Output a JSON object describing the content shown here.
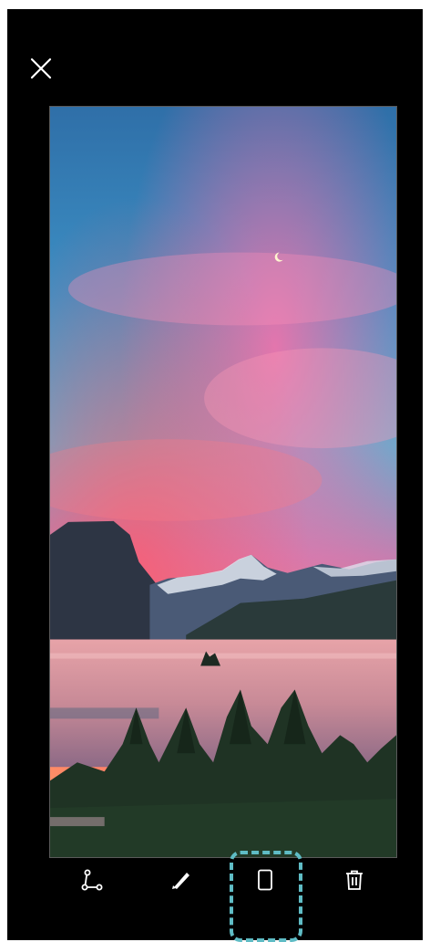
{
  "screen": {
    "close_icon": "close-icon",
    "accent_color": "#5fbcc5"
  },
  "toolbar": {
    "items": [
      {
        "id": "share",
        "icon": "share-icon",
        "label": ""
      },
      {
        "id": "edit",
        "icon": "pencil-icon",
        "label": ""
      },
      {
        "id": "scrollshot",
        "icon": "phone-outline-icon",
        "label": ""
      },
      {
        "id": "delete",
        "icon": "trash-icon",
        "label": ""
      }
    ]
  }
}
